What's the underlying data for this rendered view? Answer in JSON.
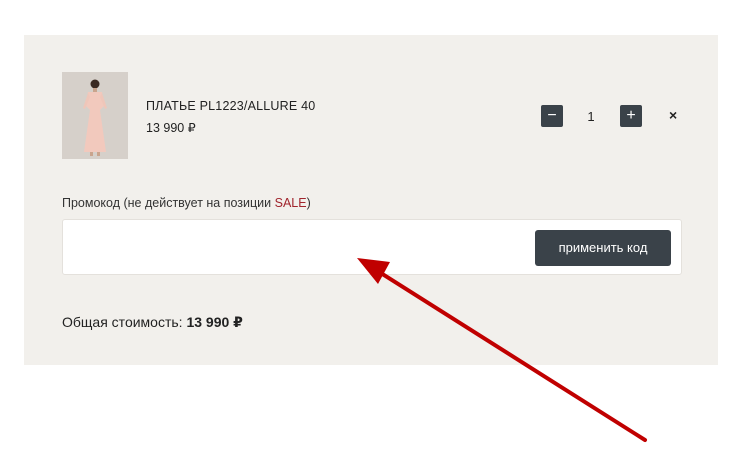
{
  "cart": {
    "item": {
      "name": "ПЛАТЬЕ PL1223/ALLURE 40",
      "price": "13 990 ₽",
      "quantity": "1",
      "minus_label": "−",
      "plus_label": "+",
      "remove_label": "×"
    },
    "promo": {
      "label_prefix": "Промокод (не действует на позиции ",
      "label_sale": "SALE",
      "label_suffix": ")",
      "input_value": "",
      "apply_label": "применить код"
    },
    "total": {
      "label": "Общая стоимость: ",
      "amount": "13 990  ₽"
    }
  },
  "colors": {
    "panel_bg": "#f2f0ec",
    "button_dark": "#3a4249",
    "sale_red": "#a0242c",
    "annotation_arrow": "#c00000"
  },
  "icons": {
    "product_image": "dress-photo",
    "annotation": "red-arrow-icon"
  }
}
